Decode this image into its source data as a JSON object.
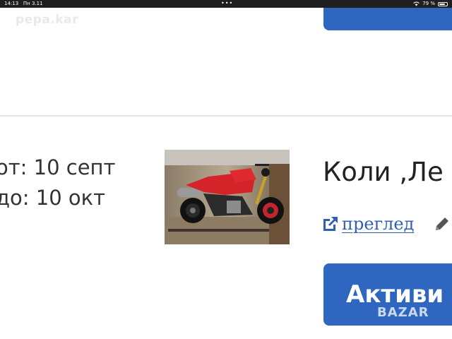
{
  "status_bar": {
    "time": "14:13",
    "date": "Пн 3.11",
    "battery_percent": "79 %",
    "battery_level": 0.79,
    "multitask_dots": "•••"
  },
  "watermark": "pepa.kar",
  "listing": {
    "date_from": "от: 10 септ",
    "date_to": "до: 10 окт",
    "title": "Коли ,Ле",
    "preview_link": "преглед",
    "activate_button": "Активи"
  },
  "brand_logo": "BAZAR",
  "colors": {
    "primary_button": "#2f67c0",
    "link": "#2f5fb3",
    "divider": "#e5e5e5",
    "status_bar": "#1f1f1f"
  },
  "icons": {
    "preview": "external-link-icon",
    "edit": "pencil-icon",
    "wifi": "wifi-icon",
    "battery": "battery-icon"
  }
}
